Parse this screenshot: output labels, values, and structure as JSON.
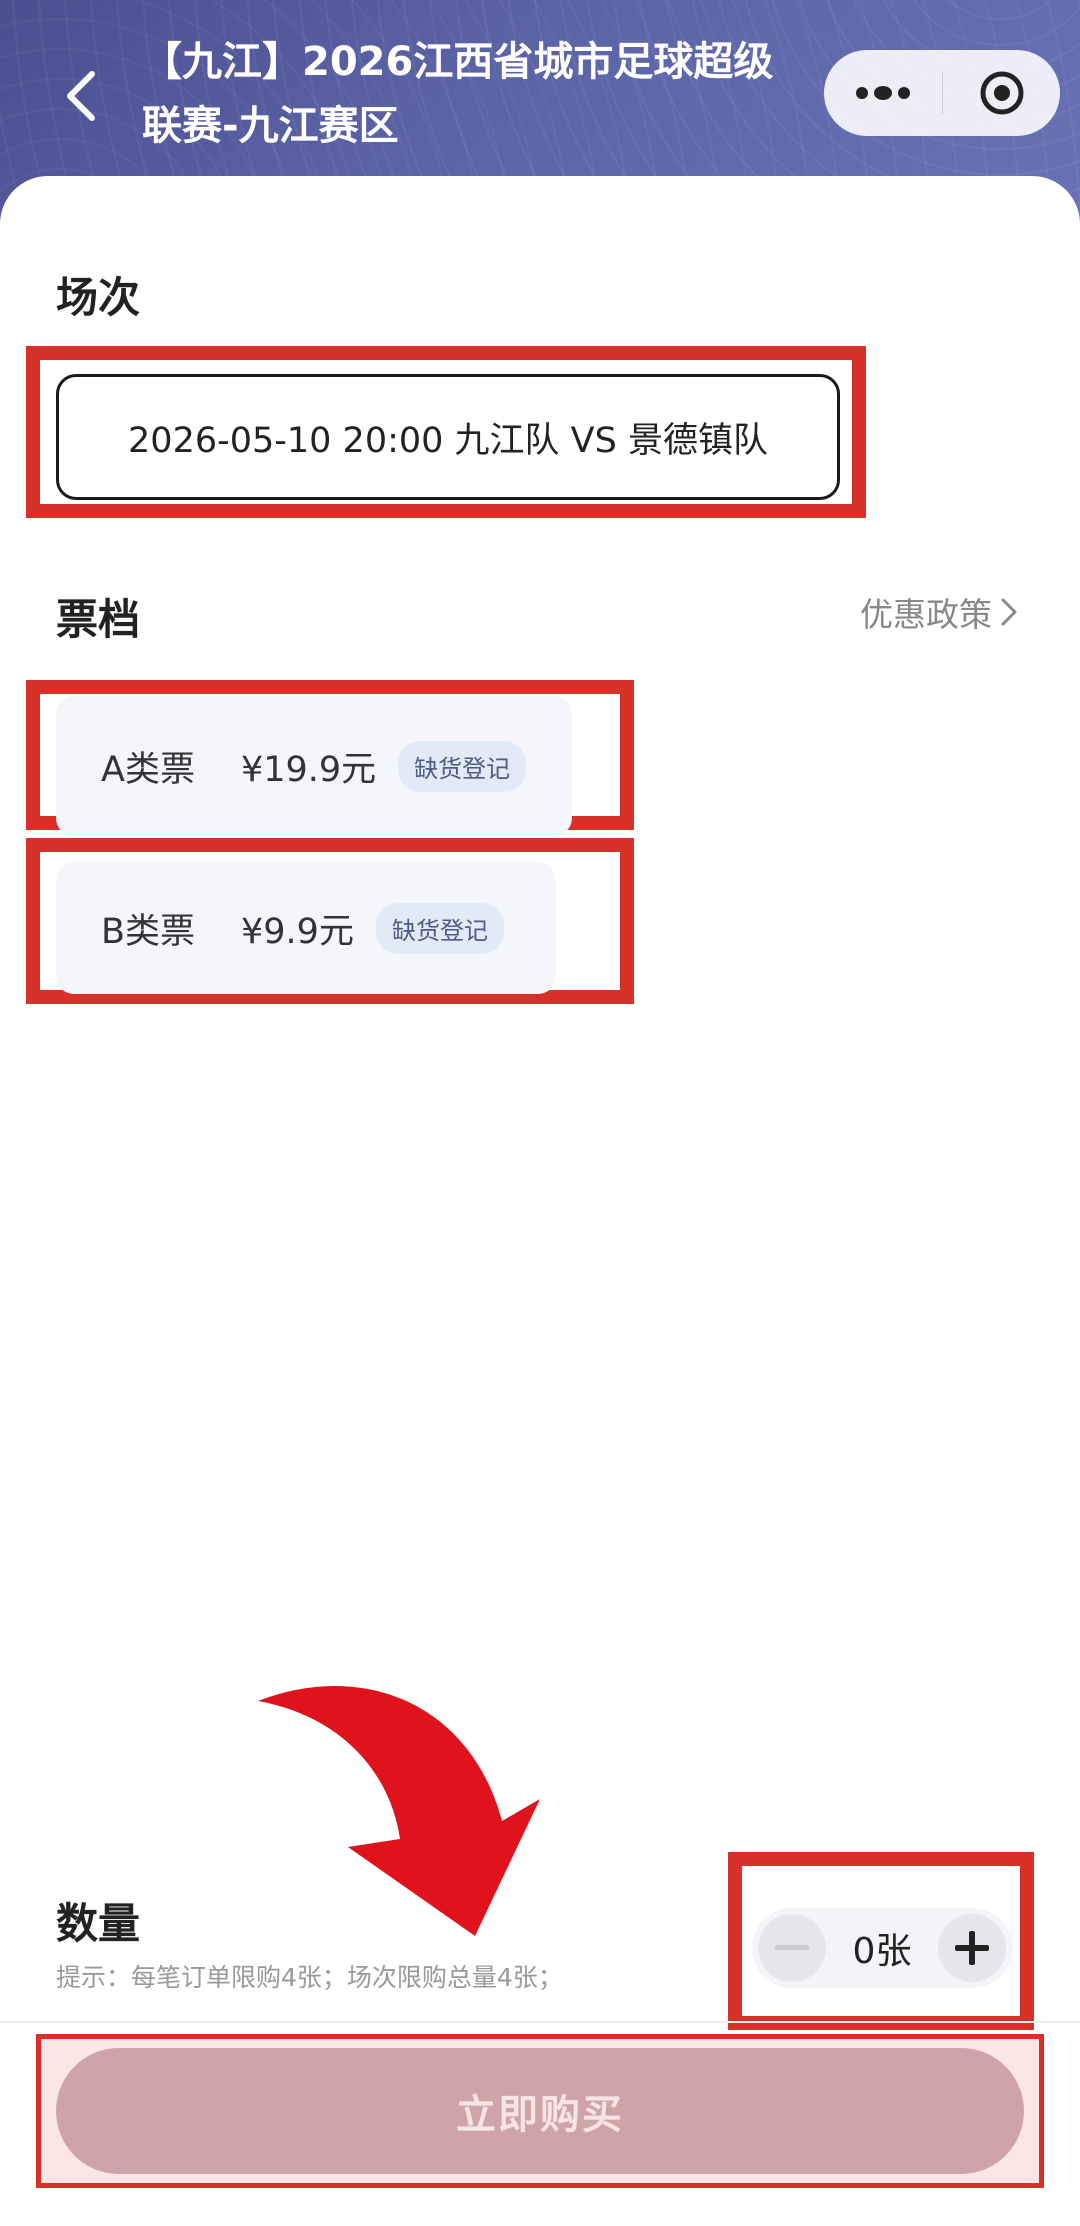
{
  "header": {
    "title": "【九江】2026江西省城市足球超级联赛-九江赛区",
    "back_icon": "chevron-left-icon",
    "more_icon": "more-dots-icon",
    "target_icon": "target-circle-icon"
  },
  "session": {
    "title": "场次",
    "selected_option": "2026-05-10 20:00 九江队 VS 景德镇队"
  },
  "tiers": {
    "title": "票档",
    "promo_link": "优惠政策",
    "items": [
      {
        "name": "A类票",
        "price": "¥19.9元",
        "badge": "缺货登记"
      },
      {
        "name": "B类票",
        "price": "¥9.9元",
        "badge": "缺货登记"
      }
    ]
  },
  "quantity": {
    "title": "数量",
    "hint": "提示：每笔订单限购4张；场次限购总量4张；",
    "count": "0张"
  },
  "buy_button": {
    "label": "立即购买"
  },
  "colors": {
    "highlight": "#d9312a",
    "header_bg": "#5c64a8",
    "buy_button_bg": "#cfa4a8"
  }
}
